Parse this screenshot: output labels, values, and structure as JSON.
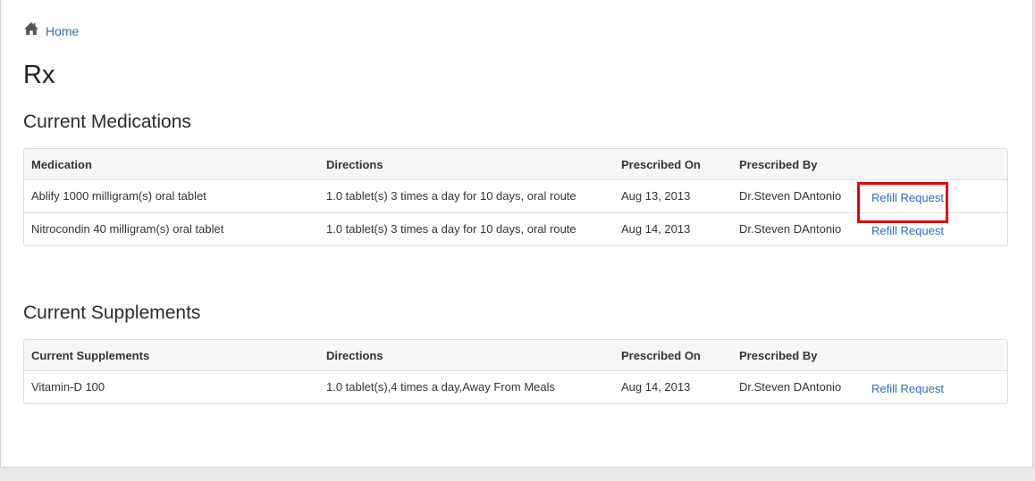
{
  "breadcrumb": {
    "icon": "home-icon",
    "home_label": "Home"
  },
  "page_title": "Rx",
  "medications": {
    "section_title": "Current Medications",
    "columns": [
      "Medication",
      "Directions",
      "Prescribed On",
      "Prescribed By",
      ""
    ],
    "rows": [
      {
        "name": "Ablify 1000 milligram(s) oral tablet",
        "directions": "1.0 tablet(s) 3 times a day for 10 days, oral route",
        "prescribed_on": "Aug 13, 2013",
        "prescribed_by": "Dr.Steven DAntonio",
        "action": "Refill Request"
      },
      {
        "name": "Nitrocondin 40 milligram(s) oral tablet",
        "directions": "1.0 tablet(s) 3 times a day for 10 days, oral route",
        "prescribed_on": "Aug 14, 2013",
        "prescribed_by": "Dr.Steven DAntonio",
        "action": "Refill Request"
      }
    ]
  },
  "supplements": {
    "section_title": "Current Supplements",
    "columns": [
      "Current Supplements",
      "Directions",
      "Prescribed On",
      "Prescribed By",
      ""
    ],
    "rows": [
      {
        "name": "Vitamin-D 100",
        "directions": "1.0 tablet(s),4 times a day,Away From Meals",
        "prescribed_on": "Aug 14, 2013",
        "prescribed_by": "Dr.Steven DAntonio",
        "action": "Refill Request"
      }
    ]
  },
  "colors": {
    "link": "#2a6ebb",
    "highlight": "#e8000b",
    "header_bg": "#f7f7f7",
    "border": "#dddddd"
  }
}
